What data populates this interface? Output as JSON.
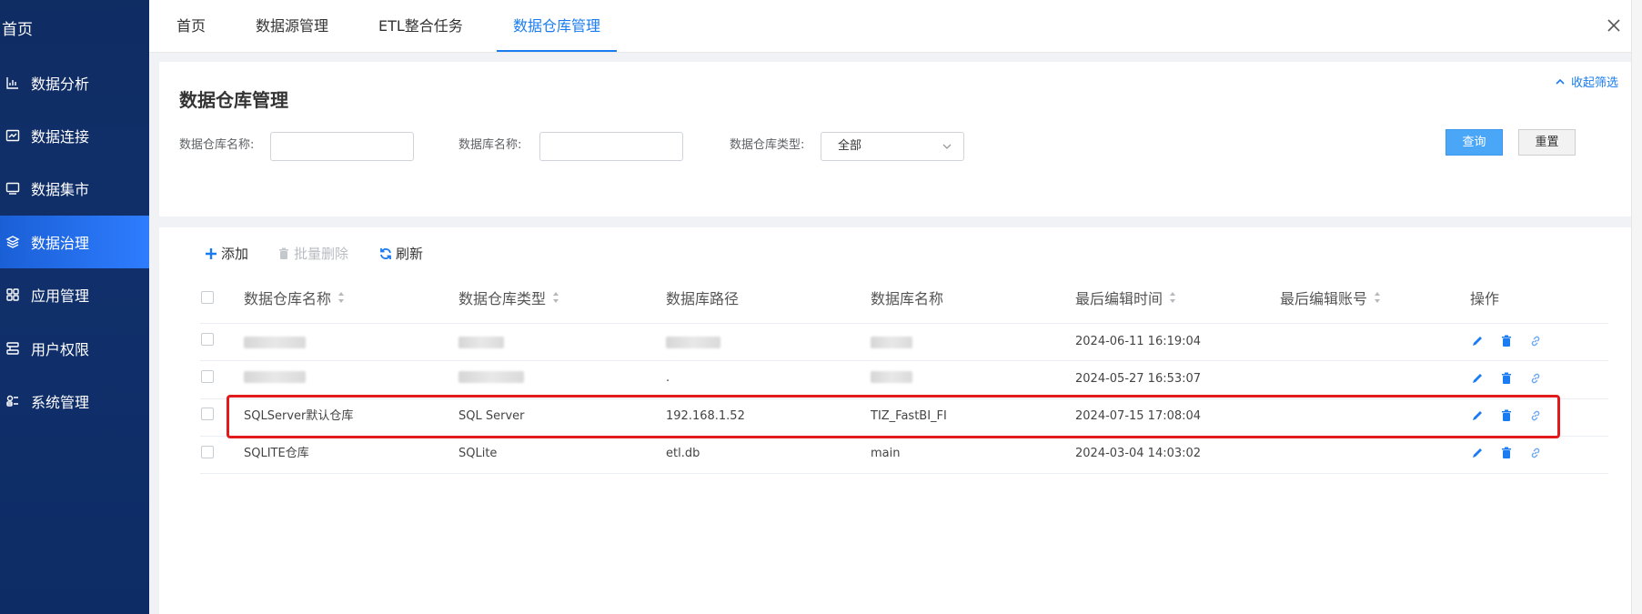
{
  "sidebar": {
    "home": "首页",
    "items": [
      {
        "label": "数据分析",
        "icon": "chart-icon"
      },
      {
        "label": "数据连接",
        "icon": "connection-icon"
      },
      {
        "label": "数据集市",
        "icon": "monitor-icon"
      },
      {
        "label": "数据治理",
        "icon": "layers-icon",
        "active": true
      },
      {
        "label": "应用管理",
        "icon": "grid-icon"
      },
      {
        "label": "用户权限",
        "icon": "user-permission-icon"
      },
      {
        "label": "系统管理",
        "icon": "system-icon"
      }
    ]
  },
  "tabs": [
    {
      "label": "首页"
    },
    {
      "label": "数据源管理"
    },
    {
      "label": "ETL整合任务"
    },
    {
      "label": "数据仓库管理",
      "active": true
    }
  ],
  "filter": {
    "title": "数据仓库管理",
    "collapse_label": "收起筛选",
    "warehouse_name_label": "数据仓库名称:",
    "database_name_label": "数据库名称:",
    "warehouse_type_label": "数据仓库类型:",
    "warehouse_type_value": "全部",
    "query_label": "查询",
    "reset_label": "重置"
  },
  "toolbar": {
    "add_label": "添加",
    "batch_delete_label": "批量删除",
    "refresh_label": "刷新"
  },
  "table": {
    "headers": [
      "数据仓库名称",
      "数据仓库类型",
      "数据库路径",
      "数据库名称",
      "最后编辑时间",
      "最后编辑账号",
      "操作"
    ],
    "rows": [
      {
        "name": "",
        "type": "",
        "path": "",
        "db": "",
        "time": "2024-06-11 16:19:04",
        "account": ""
      },
      {
        "name": "",
        "type": "",
        "path": ".",
        "db": "",
        "time": "2024-05-27 16:53:07",
        "account": ""
      },
      {
        "name": "SQLServer默认仓库",
        "type": "SQL Server",
        "path": "192.168.1.52",
        "db": "TIZ_FastBI_FI",
        "time": "2024-07-15 17:08:04",
        "account": ""
      },
      {
        "name": "SQLITE仓库",
        "type": "SQLite",
        "path": "etl.db",
        "db": "main",
        "time": "2024-03-04 14:03:02",
        "account": ""
      }
    ]
  },
  "colors": {
    "accent": "#1a7cf0",
    "highlight": "#e11b1b",
    "sidebar_bg": "#0f2c63"
  }
}
